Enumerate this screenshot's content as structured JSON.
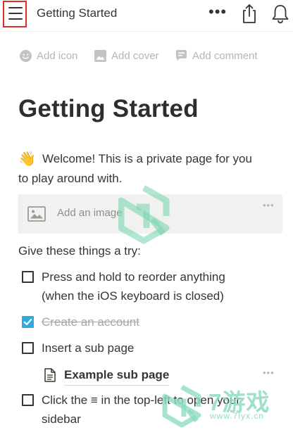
{
  "header": {
    "title": "Getting Started",
    "more_label": "•••"
  },
  "page_actions": {
    "add_icon": "Add icon",
    "add_cover": "Add cover",
    "add_comment": "Add comment"
  },
  "page": {
    "title": "Getting Started",
    "welcome_emoji": "👋",
    "welcome_line1": "Welcome! This is a private page for you",
    "welcome_line2": "to play around with.",
    "image_block_label": "Add an image",
    "block_more": "•••",
    "try_heading": "Give these things a try:",
    "todos": [
      {
        "line1": "Press and hold to reorder anything",
        "line2": "(when the iOS keyboard is closed)",
        "checked": false
      },
      {
        "line1": "Create an account",
        "checked": true
      },
      {
        "line1": "Insert a sub page",
        "checked": false
      },
      {
        "line1": "Click the ≡ in the top-left to open your",
        "line2": "sidebar",
        "checked": false
      }
    ],
    "sub_page_label": "Example sub page"
  },
  "watermark": {
    "text": "7游戏",
    "url": "www.7lyx.cn"
  },
  "colors": {
    "text": "#37352f",
    "muted": "#b6b5b2",
    "checkbox_checked": "#2eaadc",
    "highlight_border": "#e0312b",
    "image_block_bg": "#f1f1ef",
    "watermark": "#7dd6b3"
  },
  "icons": {
    "menu": "hamburger-icon",
    "more": "more-horizontal-icon",
    "share": "share-icon",
    "notifications": "bell-icon",
    "add_icon": "smiley-icon",
    "add_cover": "image-icon",
    "add_comment": "comment-icon",
    "image_block": "image-icon",
    "sub_page": "document-icon",
    "checkbox_checked": "checkmark-icon"
  }
}
